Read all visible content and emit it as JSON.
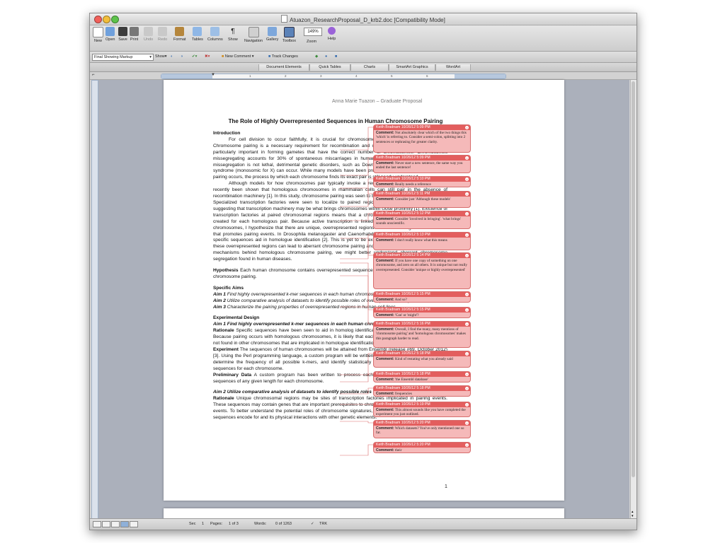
{
  "window": {
    "title": "Atuazon_ResearchProposal_D_krb2.doc [Compatibility Mode]"
  },
  "toolbar": {
    "buttons": [
      "New",
      "Open",
      "Save",
      "Print",
      "Undo",
      "Redo",
      "Format",
      "Tables",
      "Columns",
      "Show",
      "Navigation",
      "Gallery",
      "Toolbox"
    ],
    "zoom_value": "149%",
    "zoom_label": "Zoom",
    "help_label": "Help"
  },
  "review_toolbar": {
    "markup_mode": "Final Showing Markup",
    "show_label": "Show",
    "new_comment": "New Comment",
    "track_changes": "Track Changes"
  },
  "ribbon_tabs": [
    "Document Elements",
    "Quick Tables",
    "Charts",
    "SmartArt Graphics",
    "WordArt"
  ],
  "ruler_labels": [
    "1",
    "2",
    "3",
    "4",
    "5",
    "6"
  ],
  "document": {
    "header": "Anna Marie Tuazon – Graduate Proposal",
    "title": "The Role of Highly Overrepresented Sequences in Human Chromosome Pairing",
    "intro_heading": "Introduction",
    "intro_p1": "For cell division to occur faithfully, it is crucial for chromosomes to find their homologous pair. Chromosome pairing is a necessary requirement for recombination and chromosome segregation, which is particularly important in forming gametes that have the correct number of chromosomes. Chromosomes missegregating accounts for 30% of spontaneous miscarriages in humans, and in the few instances that missegregation is not lethal, detrimental genetic disorders, such as Down syndrome (trisomy 21) or Turner syndrome (monosomic for X) can occur. While many models have been proposed to explain how homologous pairing occurs, the process by which each chromosome finds its exact pair is still poorly understood.",
    "intro_p2": "Although models for how chromosomes pair typically invoke a recombination-centric process, it has recently been shown that homologous chromosomes in mammalian cells can still pair in the absence of recombination machinery [1]. In this study, chromosome pairing was seen to be influenced by active transcription. Specialized transcription factories were seen to localize to paired regions of homologous chromosomes, suggesting that transcription machinery may be what brings chromosomes within close proximity [1]. Existence of transcription factories at paired chromosomal regions means that a chromosomal transcription signature is created for each homologous pair. Because active transcription is linked to paired regions of homologous chromosomes, I hypothesize that there are unique, overrepresented regions in each homologous chromosome that promotes pairing events. In Drosophila melanogaster and Caenorhabditis elegans, there is evidence that specific sequences aid in homologue identification [2]. This is yet to be explored in human cells. Moreover, if these overrepresented regions can lead to aberrant chromosome pairing and segregation. By understanding the mechanisms behind homologous chromosome pairing, we might better understand aberrant chromosome segregation found in human diseases.",
    "hypothesis_label": "Hypothesis",
    "hypothesis_text": " Each human chromosome contains overrepresented sequences, which play a role in homologous chromosome pairing.",
    "aims_heading": "Specific Aims",
    "aim1_label": "Aim 1",
    "aim1_text": " Find highly overrepresented k-mer sequences in each human chromosome.",
    "aim2_label": "Aim 2",
    "aim2_text": " Utilize comparative analysis of datasets to identify possible roles of overrepresented sequences.",
    "aim3_label": "Aim 3",
    "aim3_text": " Characterize the pairing properties of overrepresented regions in human cell lines.",
    "design_heading": "Experimental Design",
    "design_aim1": "Aim 1 Find highly overrepresented k-mer sequences in each human chromosome.",
    "rationale_label": "Rationale",
    "rationale1_text": " Specific sequences have been seen to aid in homolog identification in Drosophila and C. elegans. Because pairing occurs with homologous chromosomes, it is likely that each chromosome contains sequences not found in other chromosomes that are implicated in homologue identification.",
    "experiment_label": "Experiment",
    "experiment_text": " The sequences of human chromosomes will be attained from Ensembl (release #69, October 2012) [3]. Using the Perl programming language, a custom program will be written to remove ambiguous nucleotides, determine the frequency of all possible k-mers, and identify statistically significant, highly overrepresented sequences for each chromosome.",
    "prelim_label": "Preliminary Data",
    "prelim_text": " A custom program has been written to process each chromosome and count possible sequences of any given length for each chromosome.",
    "design_aim2": "Aim 2 Utilize comparative analysis of datasets to identify possible roles of overrepresented sequences.",
    "rationale2_text": " Unique chromosomal regions may be sites of transcription factories implicated in pairing events. These sequences may contain genes that are important prerequisites to chromosome alignment or early meiosis events. To better understand the potential roles of chromosome signatures, it is necessary to identify what the sequences encode for and its physical interactions with other genetic elements.",
    "page_number": "1"
  },
  "comments": [
    {
      "header": "Keith Bradnam 10/26/12 5:09 PM",
      "label": "Comment:",
      "text": "Not absolutely clear which of the two things this 'which' is referring to. Consider a semi-colon, splitting into 2 sentences or rephrasing for greater clarity."
    },
    {
      "header": "Keith Bradnam 10/26/12 5:09 PM",
      "label": "Comment:",
      "text": "Never start a new sentence, the same way you ended the last sentence!"
    },
    {
      "header": "Keith Bradnam 10/26/12 5:10 PM",
      "label": "Comment:",
      "text": "Really needs a reference"
    },
    {
      "header": "Keith Bradnam 10/26/12 5:11 PM",
      "label": "Comment:",
      "text": "Consider just 'Although these models'"
    },
    {
      "header": "Keith Bradnam 10/26/12 5:12 PM",
      "label": "Comment:",
      "text": "Consider 'involved in bringing'. 'what brings' sounds unscientific."
    },
    {
      "header": "Keith Bradnam 10/26/12 5:13 PM",
      "label": "Comment:",
      "text": "I don't really know what this means"
    },
    {
      "header": "Keith Bradnam 10/26/12 5:14 PM",
      "label": "Comment:",
      "text": "If you have one copy of something on one chromosome, and zero on all others. It is unique but not really overrepresented. Consider 'unique or highly overrepresented'"
    },
    {
      "header": "Keith Bradnam 10/26/12 5:15 PM",
      "label": "Comment:",
      "text": "And so?"
    },
    {
      "header": "Keith Bradnam 10/26/12 5:15 PM",
      "label": "Comment:",
      "text": "'Can' or 'might'?"
    },
    {
      "header": "Keith Bradnam 10/26/12 5:16 PM",
      "label": "Comment:",
      "text": "Overall, I find the many, many mentions of 'chromosome pairing' and 'homologous chromosomes' makes this paragraph harder to read."
    },
    {
      "header": "Keith Bradnam 10/26/12 5:18 PM",
      "label": "Comment:",
      "text": "Kind of restating what you already said"
    },
    {
      "header": "Keith Bradnam 10/26/12 5:18 PM",
      "label": "Comment:",
      "text": "'the Ensembl database'"
    },
    {
      "header": "Keith Bradnam 10/26/12 5:18 PM",
      "label": "Comment:",
      "text": "frequencies"
    },
    {
      "header": "Keith Bradnam 10/26/12 5:19 PM",
      "label": "Comment:",
      "text": "This almost sounds like you have completed the experiment you just outlined."
    },
    {
      "header": "Keith Bradnam 10/26/12 5:20 PM",
      "label": "Comment:",
      "text": "Which datasets? You've only mentioned one so far."
    },
    {
      "header": "Keith Bradnam 10/26/12 5:20 PM",
      "label": "Comment:",
      "text": "their"
    }
  ],
  "status": {
    "sec_label": "Sec",
    "sec_value": "1",
    "pages_label": "Pages:",
    "pages_value": "1 of 3",
    "words_label": "Words:",
    "words_value": "0 of 1263",
    "trk": "TRK"
  }
}
